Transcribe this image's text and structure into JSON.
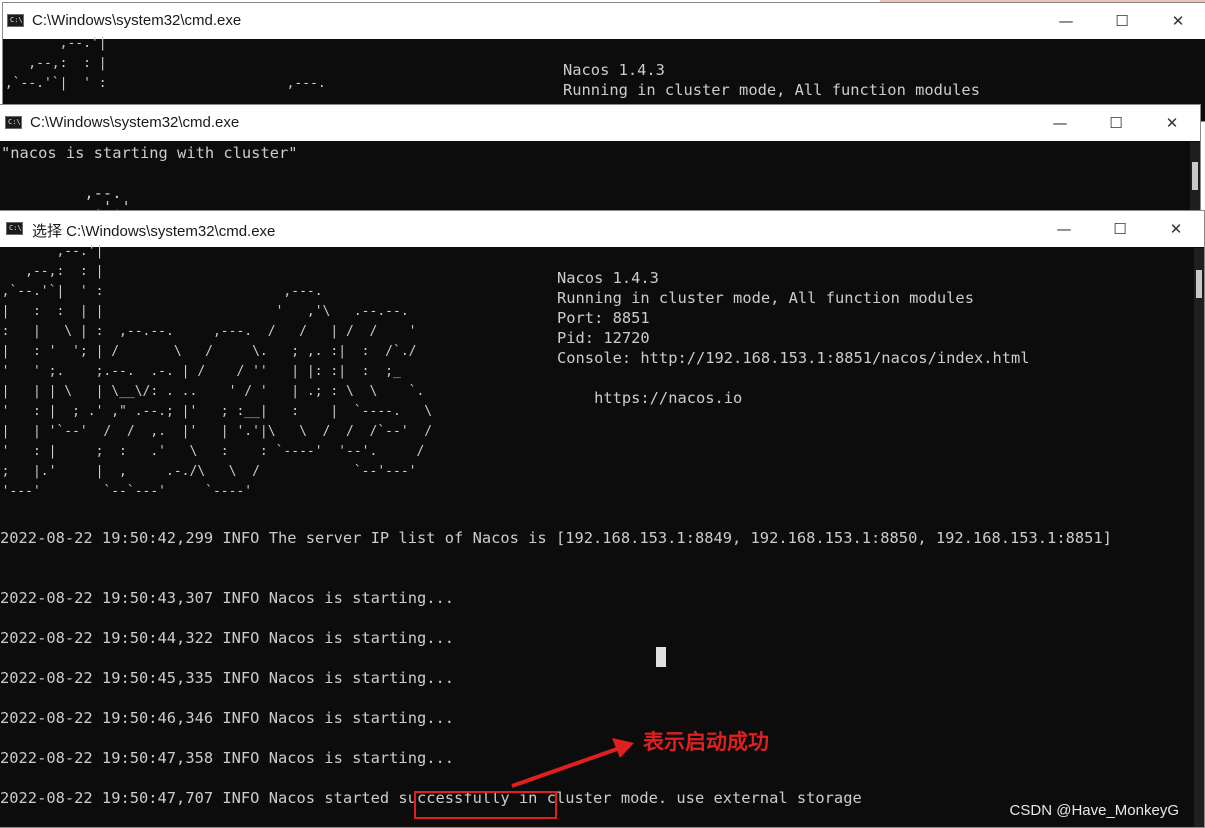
{
  "windows": [
    {
      "title": "C:\\Windows\\system32\\cmd.exe",
      "ascii_logo": "        ,--.'|\n    ,--,:  : |\n ,`--.'`|  ' :                       ,---.",
      "info_lines": [
        "Nacos 1.4.3",
        "Running in cluster mode, All function modules"
      ]
    },
    {
      "title": "C:\\Windows\\system32\\cmd.exe",
      "lines": [
        "\"nacos is starting with cluster\"",
        "",
        "         ,--.",
        "          ,'.'"
      ]
    },
    {
      "title": "选择 C:\\Windows\\system32\\cmd.exe",
      "ascii_logo": "         ,--.'|\n     ,--,:  : |\n  ,`--.'`|  ' :                       ,---.\n  |   :  :  | |                      '   ,'\\   .--.--.\n  :   |   \\ | :  ,--.--.     ,---.  /   /   | /  /    '\n  |   : '  '; | /       \\   /     \\.   ; ,. :|  :  /`./\n  '   ' ;.    ;.--.  .-. | /    / ''   | |: :|  :  ;_\n  |   | | \\   | \\__\\/: . ..    ' / '   | .; : \\  \\    `.\n  '   : |  ; .' ,\" .--.; |'   ; :__|   :    |  `----.   \\\n  |   | '`--'  /  /  ,.  |'   | '.'|\\   \\  /  /  /`--'  /\n  '   : |     ;  :   .'   \\   :    : `----'  '--'.     /\n  ;   |.'     |  ,     .-./\\   \\  /            `--'---'\n  '---'        `--`---'     `----'",
      "info_lines": [
        "Nacos 1.4.3",
        "Running in cluster mode, All function modules",
        "Port: 8851",
        "Pid: 12720",
        "Console: http://192.168.153.1:8851/nacos/index.html",
        "",
        "    https://nacos.io"
      ],
      "log_lines": [
        "2022-08-22 19:50:42,299 INFO The server IP list of Nacos is [192.168.153.1:8849, 192.168.153.1:8850, 192.168.153.1:8851]",
        "",
        "",
        "2022-08-22 19:50:43,307 INFO Nacos is starting...",
        "",
        "2022-08-22 19:50:44,322 INFO Nacos is starting...",
        "",
        "2022-08-22 19:50:45,335 INFO Nacos is starting...",
        "",
        "2022-08-22 19:50:46,346 INFO Nacos is starting...",
        "",
        "2022-08-22 19:50:47,358 INFO Nacos is starting...",
        "",
        "2022-08-22 19:50:47,707 INFO Nacos started successfully in cluster mode. use external storage"
      ]
    }
  ],
  "window_controls": {
    "minimize": "—",
    "maximize": "☐",
    "close": "✕"
  },
  "app_icon_label": "C:\\.",
  "annotation": {
    "text": "表示启动成功",
    "color": "#e02020"
  },
  "watermark": "CSDN @Have_MonkeyG"
}
